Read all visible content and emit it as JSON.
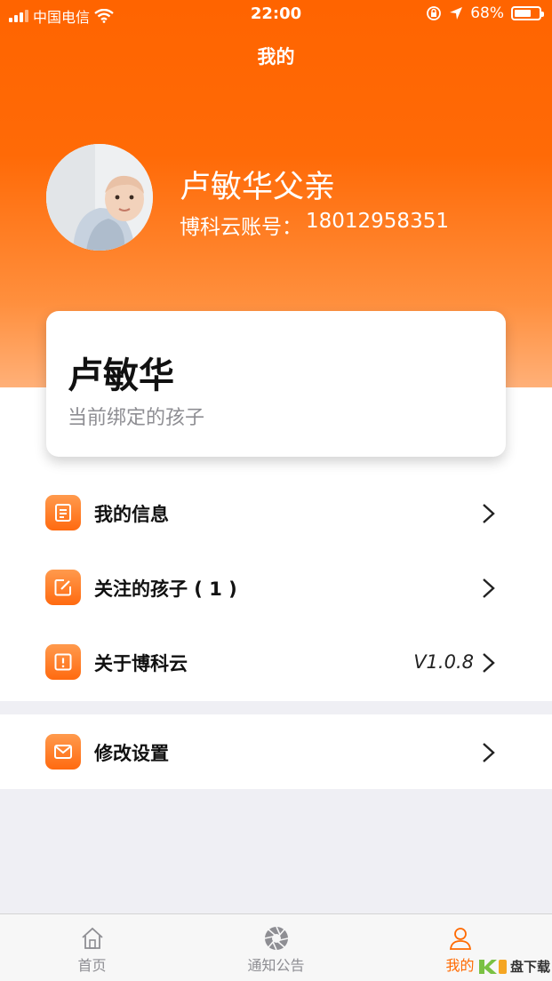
{
  "status_bar": {
    "carrier": "中国电信",
    "time": "22:00",
    "battery_percent": "68%",
    "battery_level": 0.68
  },
  "nav": {
    "title": "我的"
  },
  "profile": {
    "name": "卢敏华父亲",
    "account_label": "博科云账号：",
    "account_number": "18012958351"
  },
  "child_card": {
    "name": "卢敏华",
    "subtitle": "当前绑定的孩子"
  },
  "menu": [
    {
      "label": "我的信息",
      "icon": "document-icon",
      "value": ""
    },
    {
      "label": "关注的孩子 ( 1 )",
      "icon": "edit-icon",
      "value": ""
    },
    {
      "label": "关于博科云",
      "icon": "exclamation-icon",
      "value": "V1.0.8"
    },
    {
      "label": "修改设置",
      "icon": "mail-icon",
      "value": ""
    }
  ],
  "tabbar": {
    "tabs": [
      {
        "label": "首页",
        "icon": "home-icon",
        "active": false
      },
      {
        "label": "通知公告",
        "icon": "shutter-icon",
        "active": false
      },
      {
        "label": "我的",
        "icon": "person-icon",
        "active": true
      }
    ]
  },
  "watermark": {
    "text": "盘下载"
  },
  "colors": {
    "accent": "#ff6a00",
    "background": "#efeff4"
  }
}
